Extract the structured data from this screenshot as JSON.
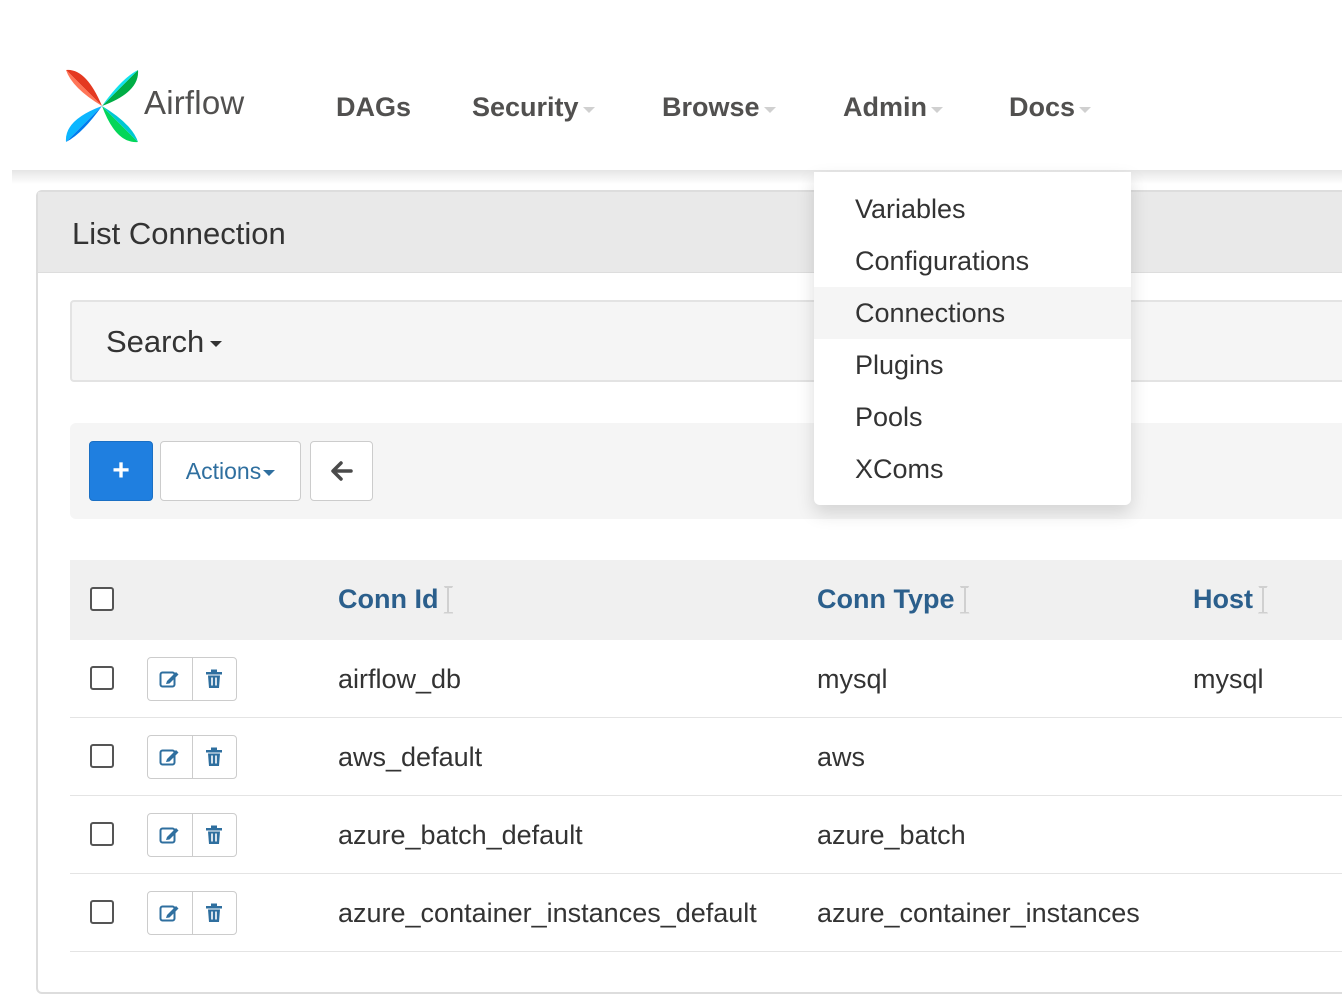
{
  "brand": {
    "name": "Airflow"
  },
  "nav": {
    "items": [
      {
        "label": "DAGs",
        "has_caret": false
      },
      {
        "label": "Security",
        "has_caret": true
      },
      {
        "label": "Browse",
        "has_caret": true
      },
      {
        "label": "Admin",
        "has_caret": true
      },
      {
        "label": "Docs",
        "has_caret": true
      }
    ]
  },
  "admin_menu": {
    "items": [
      {
        "label": "Variables",
        "active": false
      },
      {
        "label": "Configurations",
        "active": false
      },
      {
        "label": "Connections",
        "active": true
      },
      {
        "label": "Plugins",
        "active": false
      },
      {
        "label": "Pools",
        "active": false
      },
      {
        "label": "XComs",
        "active": false
      }
    ]
  },
  "panel": {
    "title": "List Connection"
  },
  "search": {
    "label": "Search"
  },
  "toolbar": {
    "add_label": "+",
    "actions_label": "Actions",
    "back_icon": "arrow-left-icon"
  },
  "table": {
    "columns": [
      "Conn Id",
      "Conn Type",
      "Host"
    ],
    "rows": [
      {
        "conn_id": "airflow_db",
        "conn_type": "mysql",
        "host": "mysql"
      },
      {
        "conn_id": "aws_default",
        "conn_type": "aws",
        "host": ""
      },
      {
        "conn_id": "azure_batch_default",
        "conn_type": "azure_batch",
        "host": ""
      },
      {
        "conn_id": "azure_container_instances_default",
        "conn_type": "azure_container_instances",
        "host": ""
      }
    ]
  },
  "colors": {
    "primary": "#1f7fe0",
    "link": "#2b5f8c",
    "nav_text": "#51504f"
  }
}
